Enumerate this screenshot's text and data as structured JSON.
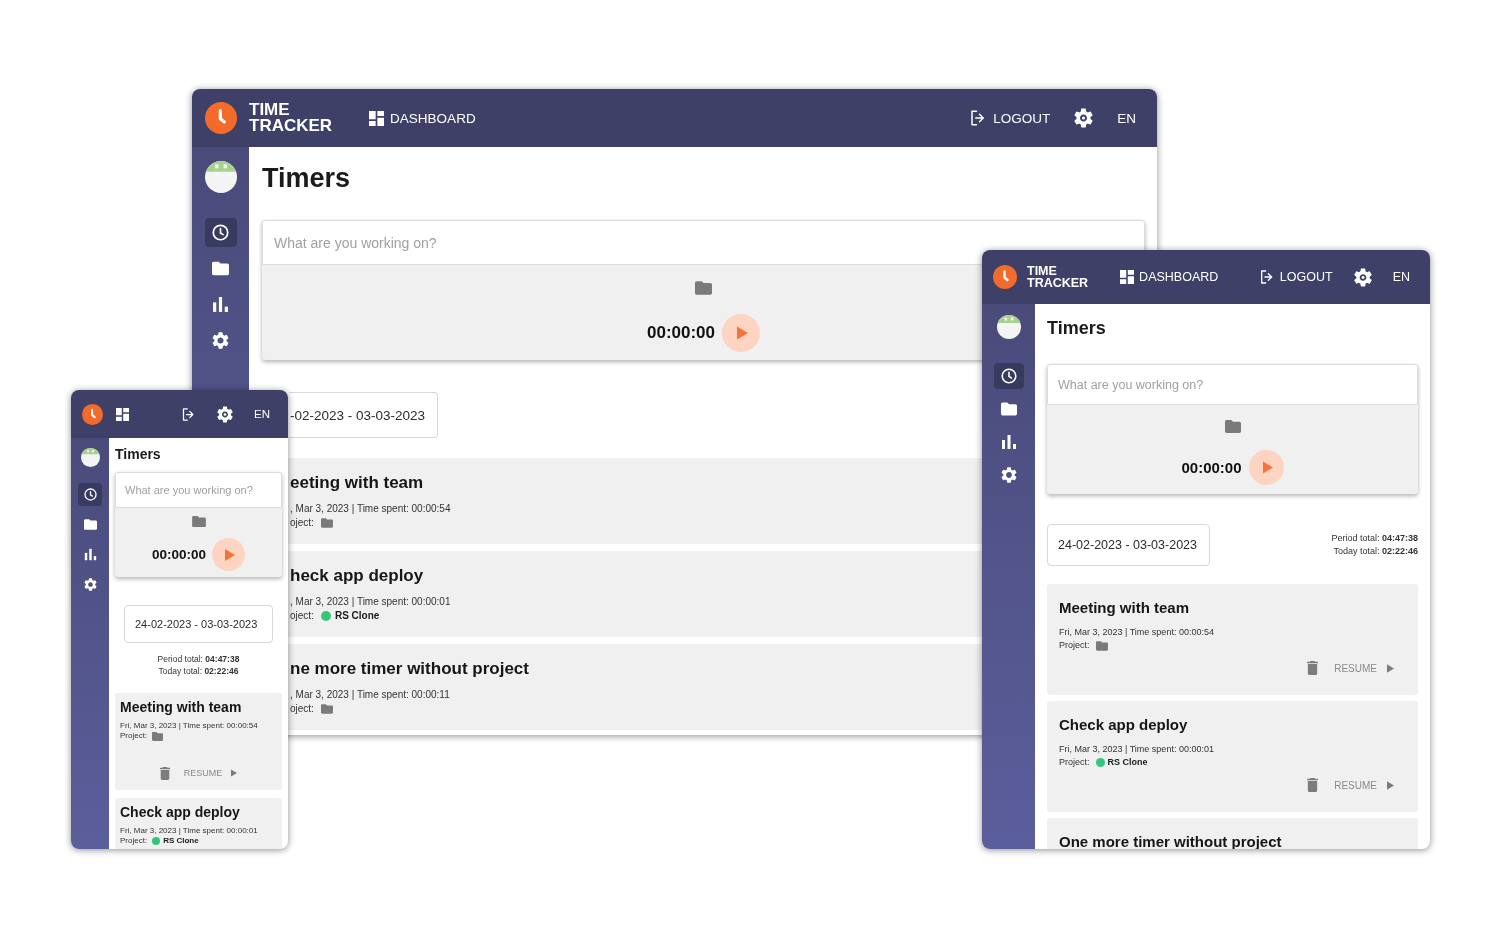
{
  "windows": [
    {
      "kind": "desktop",
      "header": {
        "brand": "TIME TRACKER",
        "nav": [
          {
            "kind": "dashboard",
            "label": "DASHBOARD"
          }
        ],
        "actions": [
          {
            "kind": "logout",
            "label": "LOGOUT"
          },
          {
            "kind": "settings"
          },
          {
            "kind": "language",
            "label": "EN"
          }
        ]
      },
      "sidebar": {
        "items": [
          {
            "kind": "clock",
            "selected": true
          },
          {
            "kind": "folder",
            "selected": false
          },
          {
            "kind": "chart",
            "selected": false
          },
          {
            "kind": "gear",
            "selected": false
          }
        ]
      },
      "page_title": "Timers",
      "timer": {
        "placeholder": "What are you working on?",
        "time": "00:00:00"
      },
      "date_range": "-02-2023 - 03-03-2023",
      "entries": [
        {
          "title": "eeting with team",
          "meta": ", Mar 3, 2023 | Time spent: 00:00:54",
          "project_label": "oject:"
        },
        {
          "title": "heck app deploy",
          "meta": ", Mar 3, 2023 | Time spent: 00:00:01",
          "project_label": "oject:",
          "project": {
            "name": "RS Clone",
            "color": "#34c77b"
          }
        },
        {
          "title": "ne more timer without project",
          "meta": ", Mar 3, 2023 | Time spent: 00:00:11",
          "project_label": "oject:"
        }
      ]
    },
    {
      "kind": "mobile",
      "header": {
        "nav": [
          {
            "kind": "dashboard"
          }
        ],
        "actions": [
          {
            "kind": "logout"
          },
          {
            "kind": "settings"
          },
          {
            "kind": "language",
            "label": "EN"
          }
        ]
      },
      "sidebar": {
        "items": [
          {
            "kind": "clock",
            "selected": true
          },
          {
            "kind": "folder",
            "selected": false
          },
          {
            "kind": "chart",
            "selected": false
          },
          {
            "kind": "gear",
            "selected": false
          }
        ]
      },
      "page_title": "Timers",
      "timer": {
        "placeholder": "What are you working on?",
        "time": "00:00:00"
      },
      "date_range": "24-02-2023 - 03-03-2023",
      "totals": [
        "Period total: **04:47:38**",
        "Today total: **02:22:46**"
      ],
      "entries": [
        {
          "title": "Meeting with team",
          "meta": "Fri, Mar 3, 2023 | Time spent: 00:00:54",
          "project_label": "Project:",
          "resume_label": "RESUME"
        },
        {
          "title": "Check app deploy",
          "meta": "Fri, Mar 3, 2023 | Time spent: 00:00:01",
          "project_label": "Project:",
          "project": {
            "name": "RS Clone",
            "color": "#34c77b"
          }
        }
      ]
    },
    {
      "kind": "tablet",
      "header": {
        "brand": "TIME TRACKER",
        "nav": [
          {
            "kind": "dashboard",
            "label": "DASHBOARD"
          }
        ],
        "actions": [
          {
            "kind": "logout",
            "label": "LOGOUT"
          },
          {
            "kind": "settings"
          },
          {
            "kind": "language",
            "label": "EN"
          }
        ]
      },
      "sidebar": {
        "items": [
          {
            "kind": "clock",
            "selected": true
          },
          {
            "kind": "folder",
            "selected": false
          },
          {
            "kind": "chart",
            "selected": false
          },
          {
            "kind": "gear",
            "selected": false
          }
        ]
      },
      "page_title": "Timers",
      "timer": {
        "placeholder": "What are you working on?",
        "time": "00:00:00"
      },
      "date_range": "24-02-2023 - 03-03-2023",
      "totals": [
        "Period total: **04:47:38**",
        "Today total: **02:22:46**"
      ],
      "entries": [
        {
          "title": "Meeting with team",
          "meta": "Fri, Mar 3, 2023 | Time spent: 00:00:54",
          "project_label": "Project:",
          "resume_label": "RESUME"
        },
        {
          "title": "Check app deploy",
          "meta": "Fri, Mar 3, 2023 | Time spent: 00:00:01",
          "project_label": "Project:",
          "project": {
            "name": "RS Clone",
            "color": "#34c77b"
          },
          "resume_label": "RESUME"
        },
        {
          "title": "One more timer without project"
        }
      ]
    }
  ]
}
